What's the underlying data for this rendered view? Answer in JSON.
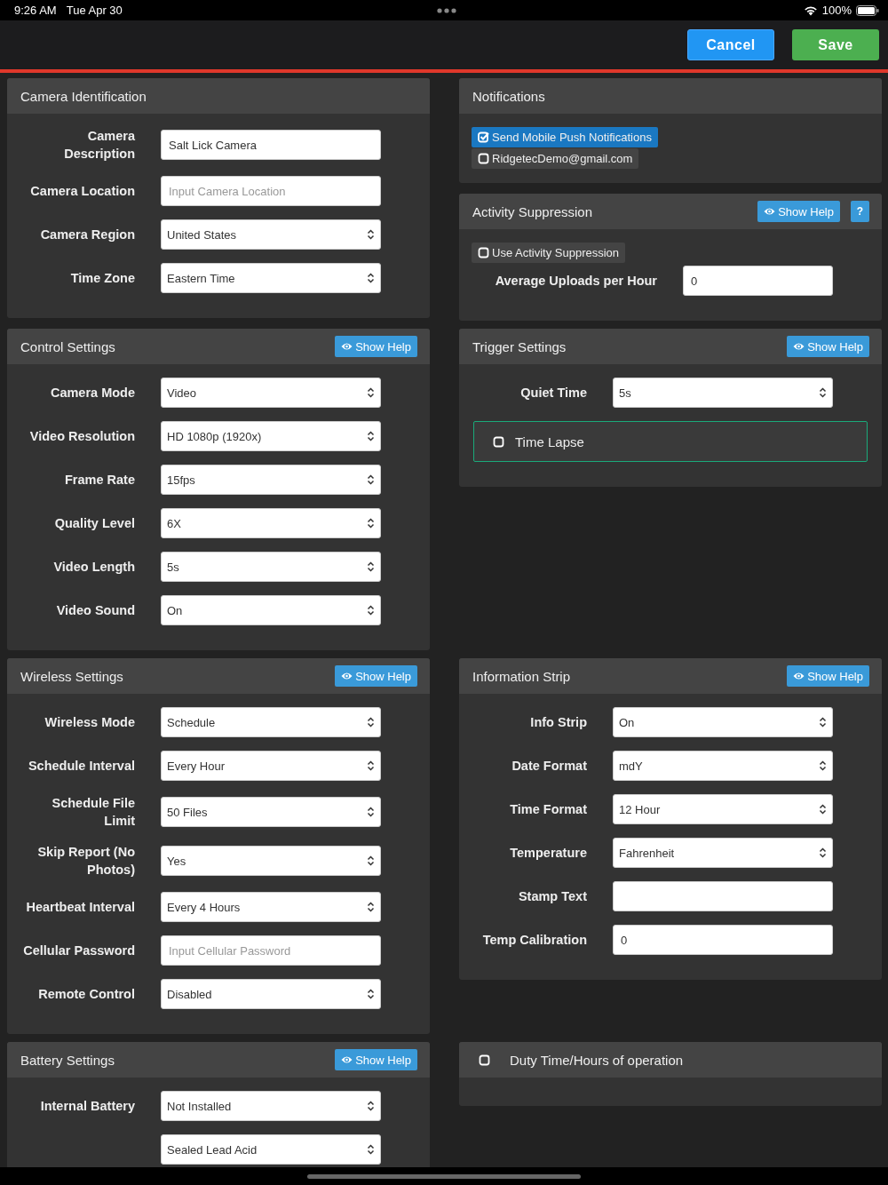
{
  "status_bar": {
    "time": "9:26 AM",
    "date": "Tue Apr 30",
    "battery": "100%"
  },
  "toolbar": {
    "buttons": [
      {
        "label": "Cancel",
        "kind": "cancel"
      },
      {
        "label": "Save",
        "kind": "save"
      }
    ]
  },
  "sections": [
    {
      "left": [
        {
          "title": "Camera Identification",
          "items": [
            {
              "kind": "text_field",
              "label": "Camera Description",
              "value": "Salt Lick Camera"
            },
            {
              "kind": "text_field",
              "label": "Camera Location",
              "placeholder": "Input Camera Location"
            },
            {
              "kind": "select_field",
              "label": "Camera Region",
              "value": "United States"
            },
            {
              "kind": "select_field",
              "label": "Time Zone",
              "value": "Eastern Time"
            }
          ]
        }
      ],
      "right": [
        {
          "title": "Notifications",
          "items": [
            {
              "kind": "toggle",
              "label": "Send Mobile Push Notifications",
              "checked": true
            },
            {
              "kind": "toggle",
              "label": "RidgetecDemo@gmail.com",
              "checked": false
            }
          ]
        },
        {
          "title": "Activity Suppression",
          "help_button": "Show Help",
          "extra_button": "?",
          "items": [
            {
              "kind": "toggle",
              "label": "Use Activity Suppression",
              "checked": false
            },
            {
              "kind": "wide_text_field",
              "label": "Average Uploads per Hour",
              "value": "0"
            }
          ]
        }
      ]
    },
    {
      "left": [
        {
          "title": "Control Settings",
          "help_button": "Show Help",
          "items": [
            {
              "kind": "select_field",
              "label": "Camera Mode",
              "value": "Video"
            },
            {
              "kind": "select_field",
              "label": "Video Resolution",
              "value": "HD 1080p (1920x)"
            },
            {
              "kind": "select_field",
              "label": "Frame Rate",
              "value": "15fps"
            },
            {
              "kind": "select_field",
              "label": "Quality Level",
              "value": "6X"
            },
            {
              "kind": "select_field",
              "label": "Video Length",
              "value": "5s"
            },
            {
              "kind": "select_field",
              "label": "Video Sound",
              "value": "On"
            }
          ]
        }
      ],
      "right": [
        {
          "title": "Trigger Settings",
          "help_button": "Show Help",
          "items": [
            {
              "kind": "select_field",
              "label": "Quiet Time",
              "value": "5s"
            },
            {
              "kind": "option_box",
              "label": "Time Lapse",
              "checked": false
            }
          ]
        }
      ]
    },
    {
      "left": [
        {
          "title": "Wireless Settings",
          "help_button": "Show Help",
          "items": [
            {
              "kind": "select_field",
              "label": "Wireless Mode",
              "value": "Schedule"
            },
            {
              "kind": "select_field",
              "label": "Schedule Interval",
              "value": "Every Hour"
            },
            {
              "kind": "select_field",
              "label": "Schedule File Limit",
              "value": "50 Files"
            },
            {
              "kind": "select_field",
              "label": "Skip Report (No Photos)",
              "value": "Yes"
            },
            {
              "kind": "select_field",
              "label": "Heartbeat Interval",
              "value": "Every 4 Hours"
            },
            {
              "kind": "text_field",
              "label": "Cellular Password",
              "placeholder": "Input Cellular Password"
            },
            {
              "kind": "select_field",
              "label": "Remote Control",
              "value": "Disabled"
            }
          ]
        }
      ],
      "right": [
        {
          "title": "Information Strip",
          "help_button": "Show Help",
          "items": [
            {
              "kind": "select_field",
              "label": "Info Strip",
              "value": "On"
            },
            {
              "kind": "select_field",
              "label": "Date Format",
              "value": "mdY"
            },
            {
              "kind": "select_field",
              "label": "Time Format",
              "value": "12 Hour"
            },
            {
              "kind": "select_field",
              "label": "Temperature",
              "value": "Fahrenheit"
            },
            {
              "kind": "text_field",
              "label": "Stamp Text"
            },
            {
              "kind": "text_field",
              "label": "Temp Calibration",
              "value": "0"
            }
          ]
        }
      ]
    },
    {
      "left": [
        {
          "title": "Battery Settings",
          "help_button": "Show Help",
          "items": [
            {
              "kind": "select_field",
              "label": "Internal Battery",
              "value": "Not Installed"
            },
            {
              "kind": "select_field",
              "value": "Sealed Lead Acid"
            }
          ]
        }
      ],
      "right": [
        {
          "kind": "checkbox_panel",
          "title": "Duty Time/Hours of operation",
          "checked": false
        }
      ]
    }
  ]
}
